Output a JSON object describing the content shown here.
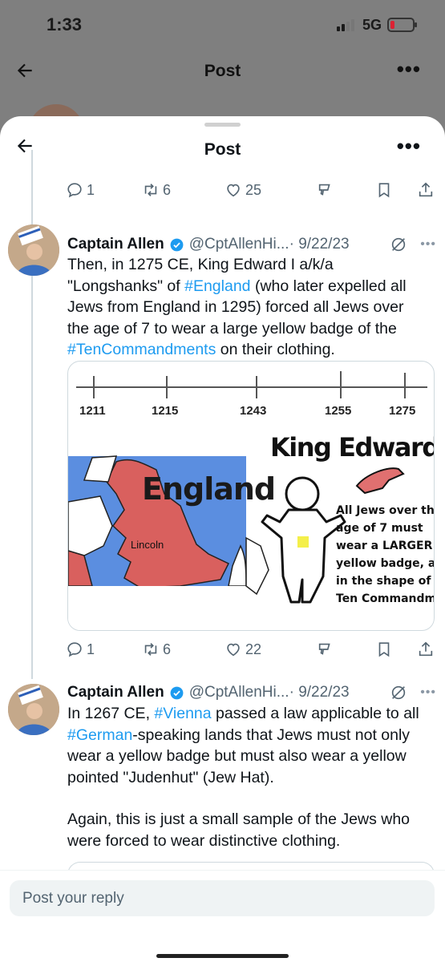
{
  "status_bar": {
    "time": "1:33",
    "network": "5G"
  },
  "header": {
    "title": "Post"
  },
  "sheet_header": {
    "title": "Post"
  },
  "prev_actions": {
    "replies": "1",
    "reposts": "6",
    "likes": "25"
  },
  "tweet1": {
    "name": "Captain Allen",
    "handle": "@CptAllenHi...",
    "date": "· 9/22/23",
    "text_parts": [
      "Then, in 1275 CE, King Edward I a/k/a \"Longshanks\" of ",
      "#England",
      " (who later expelled all Jews from England in 1295) forced all Jews over the age of 7 to wear a large yellow badge of the ",
      "#TenCommandments",
      " on their clothing."
    ],
    "actions": {
      "replies": "1",
      "reposts": "6",
      "likes": "22"
    },
    "media": {
      "timeline_years": [
        "1211",
        "1215",
        "1243",
        "1255",
        "1275"
      ],
      "map_title": "England",
      "map_city": "Lincoln",
      "heading": "King Edward I",
      "caption_lines": [
        "All Jews over the",
        "age of 7 must",
        "wear a LARGER",
        "yellow badge, and",
        "in the shape of the",
        "Ten Commandments"
      ]
    }
  },
  "tweet2": {
    "name": "Captain Allen",
    "handle": "@CptAllenHi...",
    "date": "· 9/22/23",
    "text_parts": [
      "In 1267 CE, ",
      "#Vienna",
      " passed a law applicable to all ",
      "#German",
      "-speaking lands that Jews must not only wear a yellow badge but must also wear a yellow pointed \"Judenhut\" (Jew Hat).",
      "Again, this is just a small sample of the Jews who were forced to wear distinctive clothing."
    ]
  },
  "reply": {
    "placeholder": "Post your reply"
  },
  "colors": {
    "link": "#1d9bf0",
    "verified": "#1d9bf0",
    "map_red": "#d9605e",
    "map_blue": "#5b8ee0",
    "badge_yellow": "#f4ef4a"
  },
  "icons": [
    "back-arrow-icon",
    "more-icon",
    "reply-icon",
    "repost-icon",
    "like-icon",
    "tip-icon",
    "bookmark-icon",
    "share-icon",
    "verified-icon",
    "grok-icon"
  ]
}
